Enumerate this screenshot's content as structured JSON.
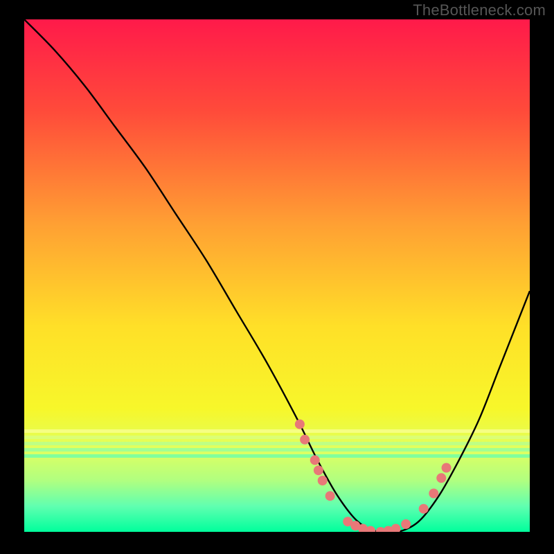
{
  "watermark": "TheBottleneck.com",
  "chart_data": {
    "type": "line",
    "title": "",
    "xlabel": "",
    "ylabel": "",
    "xlim": [
      0,
      100
    ],
    "ylim": [
      0,
      100
    ],
    "background": {
      "type": "gradient-vertical",
      "stops": [
        {
          "offset": 0.0,
          "color": "#ff1a4a"
        },
        {
          "offset": 0.18,
          "color": "#ff4b3a"
        },
        {
          "offset": 0.4,
          "color": "#ffa033"
        },
        {
          "offset": 0.6,
          "color": "#ffe028"
        },
        {
          "offset": 0.76,
          "color": "#f7f72a"
        },
        {
          "offset": 0.84,
          "color": "#e0ff60"
        },
        {
          "offset": 0.9,
          "color": "#b0ff80"
        },
        {
          "offset": 0.95,
          "color": "#60ffb0"
        },
        {
          "offset": 1.0,
          "color": "#00ff9c"
        }
      ]
    },
    "series": [
      {
        "name": "bottleneck-curve",
        "type": "line",
        "color": "#000000",
        "x": [
          0,
          6,
          12,
          18,
          24,
          30,
          36,
          42,
          48,
          54,
          58,
          62,
          66,
          70,
          74,
          78,
          82,
          86,
          90,
          94,
          98,
          100
        ],
        "y": [
          100,
          94,
          87,
          79,
          71,
          62,
          53,
          43,
          33,
          22,
          14,
          7,
          2,
          0,
          0,
          2,
          7,
          14,
          22,
          32,
          42,
          47
        ]
      }
    ],
    "scatter": {
      "name": "data-points",
      "color": "#e87878",
      "radius": 7,
      "points": [
        {
          "x": 54.5,
          "y": 21
        },
        {
          "x": 55.5,
          "y": 18
        },
        {
          "x": 57.5,
          "y": 14
        },
        {
          "x": 58.2,
          "y": 12
        },
        {
          "x": 59.0,
          "y": 10
        },
        {
          "x": 60.5,
          "y": 7
        },
        {
          "x": 64.0,
          "y": 2.0
        },
        {
          "x": 65.5,
          "y": 1.2
        },
        {
          "x": 67.0,
          "y": 0.6
        },
        {
          "x": 68.5,
          "y": 0.2
        },
        {
          "x": 70.5,
          "y": 0.0
        },
        {
          "x": 72.0,
          "y": 0.2
        },
        {
          "x": 73.5,
          "y": 0.6
        },
        {
          "x": 75.5,
          "y": 1.5
        },
        {
          "x": 79.0,
          "y": 4.5
        },
        {
          "x": 81.0,
          "y": 7.5
        },
        {
          "x": 82.5,
          "y": 10.5
        },
        {
          "x": 83.5,
          "y": 12.5
        }
      ]
    }
  }
}
